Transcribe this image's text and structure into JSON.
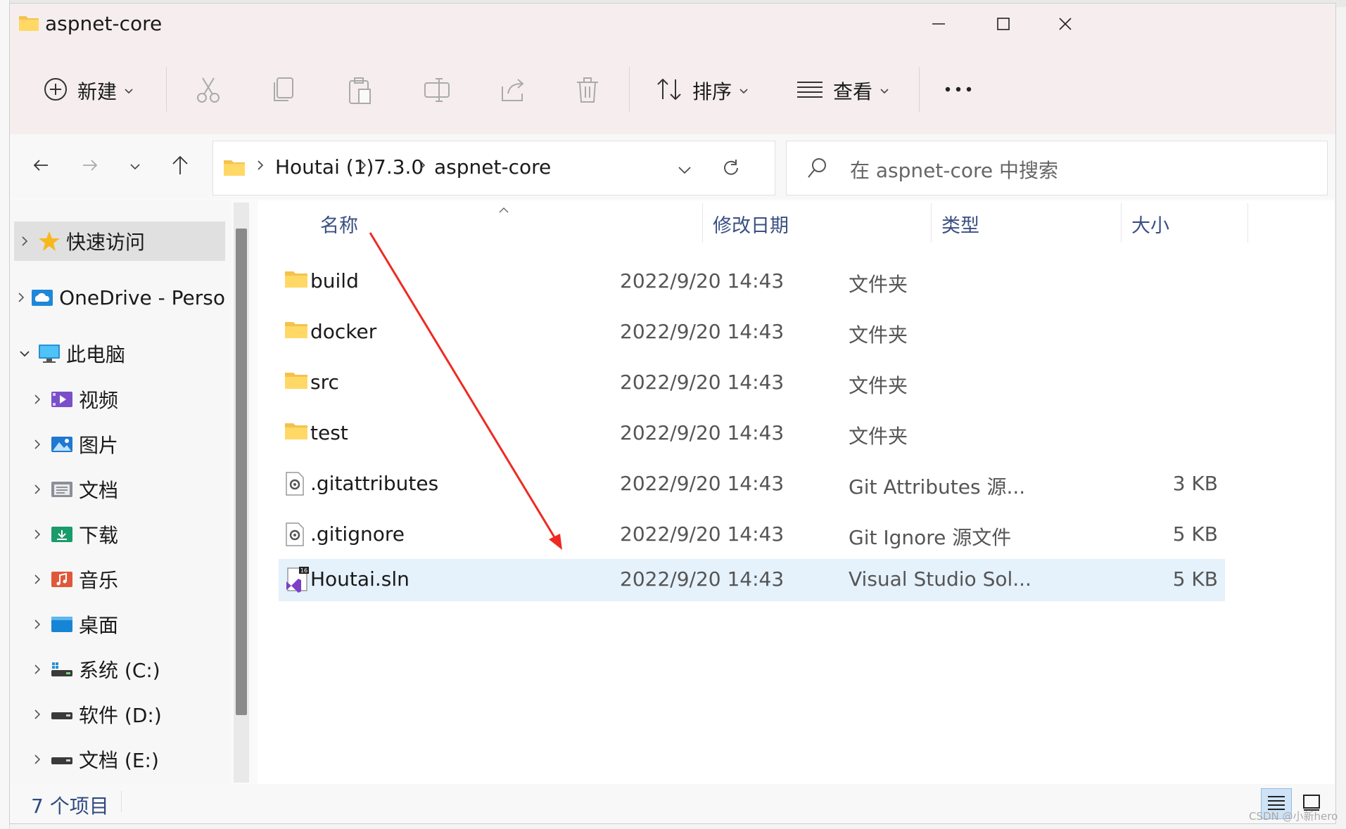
{
  "window": {
    "title": "aspnet-core",
    "minimize_icon": "minimize-icon",
    "maximize_icon": "maximize-icon",
    "close_icon": "close-icon"
  },
  "toolbar": {
    "new_label": "新建",
    "sort_label": "排序",
    "view_label": "查看",
    "more_icon": "more-icon",
    "icons": [
      "plus-circle-icon",
      "cut-icon",
      "copy-icon",
      "paste-icon",
      "rename-icon",
      "share-icon",
      "delete-icon",
      "sort-icon",
      "view-icon"
    ]
  },
  "navigation": {
    "breadcrumbs": [
      "Houtai (1)",
      "7.3.0",
      "aspnet-core"
    ],
    "search_placeholder": "在 aspnet-core 中搜索"
  },
  "sidebar": {
    "items": [
      {
        "label": "快速访问",
        "icon": "star-icon",
        "selected": true
      },
      {
        "label": "OneDrive - Perso",
        "icon": "onedrive-icon"
      },
      {
        "label": "此电脑",
        "icon": "computer-icon",
        "expanded": true
      },
      {
        "label": "视频",
        "icon": "videos-icon"
      },
      {
        "label": "图片",
        "icon": "pictures-icon"
      },
      {
        "label": "文档",
        "icon": "documents-icon"
      },
      {
        "label": "下载",
        "icon": "downloads-icon"
      },
      {
        "label": "音乐",
        "icon": "music-icon"
      },
      {
        "label": "桌面",
        "icon": "desktop-icon"
      },
      {
        "label": "系统 (C:)",
        "icon": "system-drive-icon"
      },
      {
        "label": "软件 (D:)",
        "icon": "drive-icon"
      },
      {
        "label": "文档 (E:)",
        "icon": "drive-icon"
      }
    ]
  },
  "file_list": {
    "columns": [
      "名称",
      "修改日期",
      "类型",
      "大小"
    ],
    "rows": [
      {
        "name": "build",
        "date": "2022/9/20 14:43",
        "type": "文件夹",
        "size": "",
        "icon": "folder-icon"
      },
      {
        "name": "docker",
        "date": "2022/9/20 14:43",
        "type": "文件夹",
        "size": "",
        "icon": "folder-icon"
      },
      {
        "name": "src",
        "date": "2022/9/20 14:43",
        "type": "文件夹",
        "size": "",
        "icon": "folder-icon"
      },
      {
        "name": "test",
        "date": "2022/9/20 14:43",
        "type": "文件夹",
        "size": "",
        "icon": "folder-icon"
      },
      {
        "name": ".gitattributes",
        "date": "2022/9/20 14:43",
        "type": "Git Attributes 源...",
        "size": "3 KB",
        "icon": "config-file-icon"
      },
      {
        "name": ".gitignore",
        "date": "2022/9/20 14:43",
        "type": "Git Ignore 源文件",
        "size": "5 KB",
        "icon": "config-file-icon"
      },
      {
        "name": "Houtai.sln",
        "date": "2022/9/20 14:43",
        "type": "Visual Studio Sol...",
        "size": "5 KB",
        "icon": "visual-studio-solution-icon",
        "selected": true
      }
    ]
  },
  "status": {
    "item_count": "7 个项目"
  },
  "annotation": {
    "color": "#ee2a22"
  },
  "watermark": "CSDN @小新hero",
  "colors": {
    "title_bar_bg": "#f6eeee",
    "selection_bg": "#e5f1fb",
    "header_text": "#3a4f82"
  }
}
